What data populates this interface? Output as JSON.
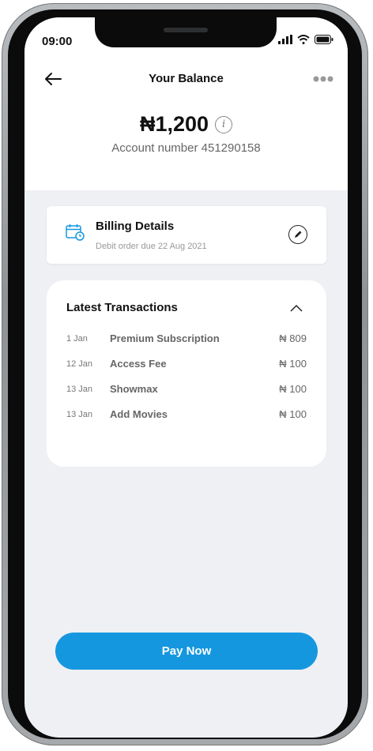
{
  "status_bar": {
    "time": "09:00"
  },
  "header": {
    "title": "Your Balance"
  },
  "balance": {
    "amount": "₦1,200",
    "account_number": "Account number 451290158"
  },
  "billing": {
    "title": "Billing Details",
    "subtitle": "Debit order due 22 Aug 2021"
  },
  "transactions": {
    "title": "Latest Transactions",
    "items": [
      {
        "date": "1 Jan",
        "name": "Premium Subscription",
        "amount": "₦ 809"
      },
      {
        "date": "12 Jan",
        "name": "Access Fee",
        "amount": "₦ 100"
      },
      {
        "date": "13 Jan",
        "name": "Showmax",
        "amount": "₦ 100"
      },
      {
        "date": "13 Jan",
        "name": "Add Movies",
        "amount": "₦ 100"
      }
    ]
  },
  "actions": {
    "pay_label": "Pay Now"
  },
  "colors": {
    "accent": "#1597e0",
    "screen_bg": "#eef0f4",
    "card_bg": "#ffffff"
  }
}
